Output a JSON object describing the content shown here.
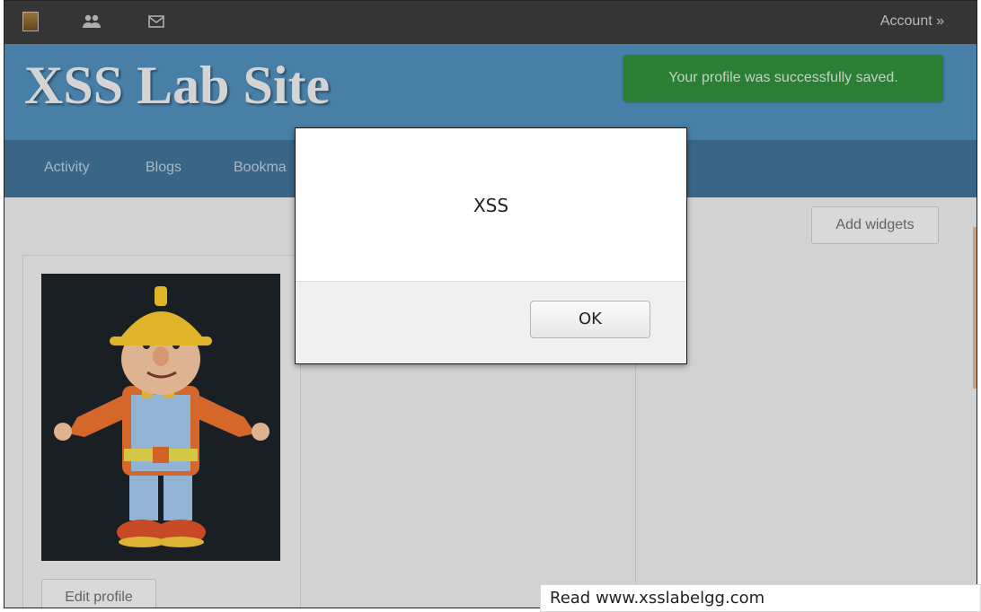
{
  "topbar": {
    "icons": [
      "avatar-thumbnail",
      "friends-icon",
      "mail-icon"
    ],
    "account_label": "Account »"
  },
  "header": {
    "site_title": "XSS Lab Site",
    "success_message": "Your profile was successfully saved."
  },
  "nav": {
    "items": [
      {
        "label": "Activity"
      },
      {
        "label": "Blogs"
      },
      {
        "label": "Bookma"
      }
    ]
  },
  "content": {
    "add_widgets_label": "Add widgets",
    "edit_profile_label": "Edit profile"
  },
  "dialog": {
    "message": "XSS",
    "ok_label": "OK"
  },
  "statusbar": {
    "text": "Read www.xsslabelgg.com"
  },
  "colors": {
    "topbar": "#3a3a3a",
    "header": "#4f8ab5",
    "nav": "#3e6f93",
    "success": "#2f8a3a"
  }
}
